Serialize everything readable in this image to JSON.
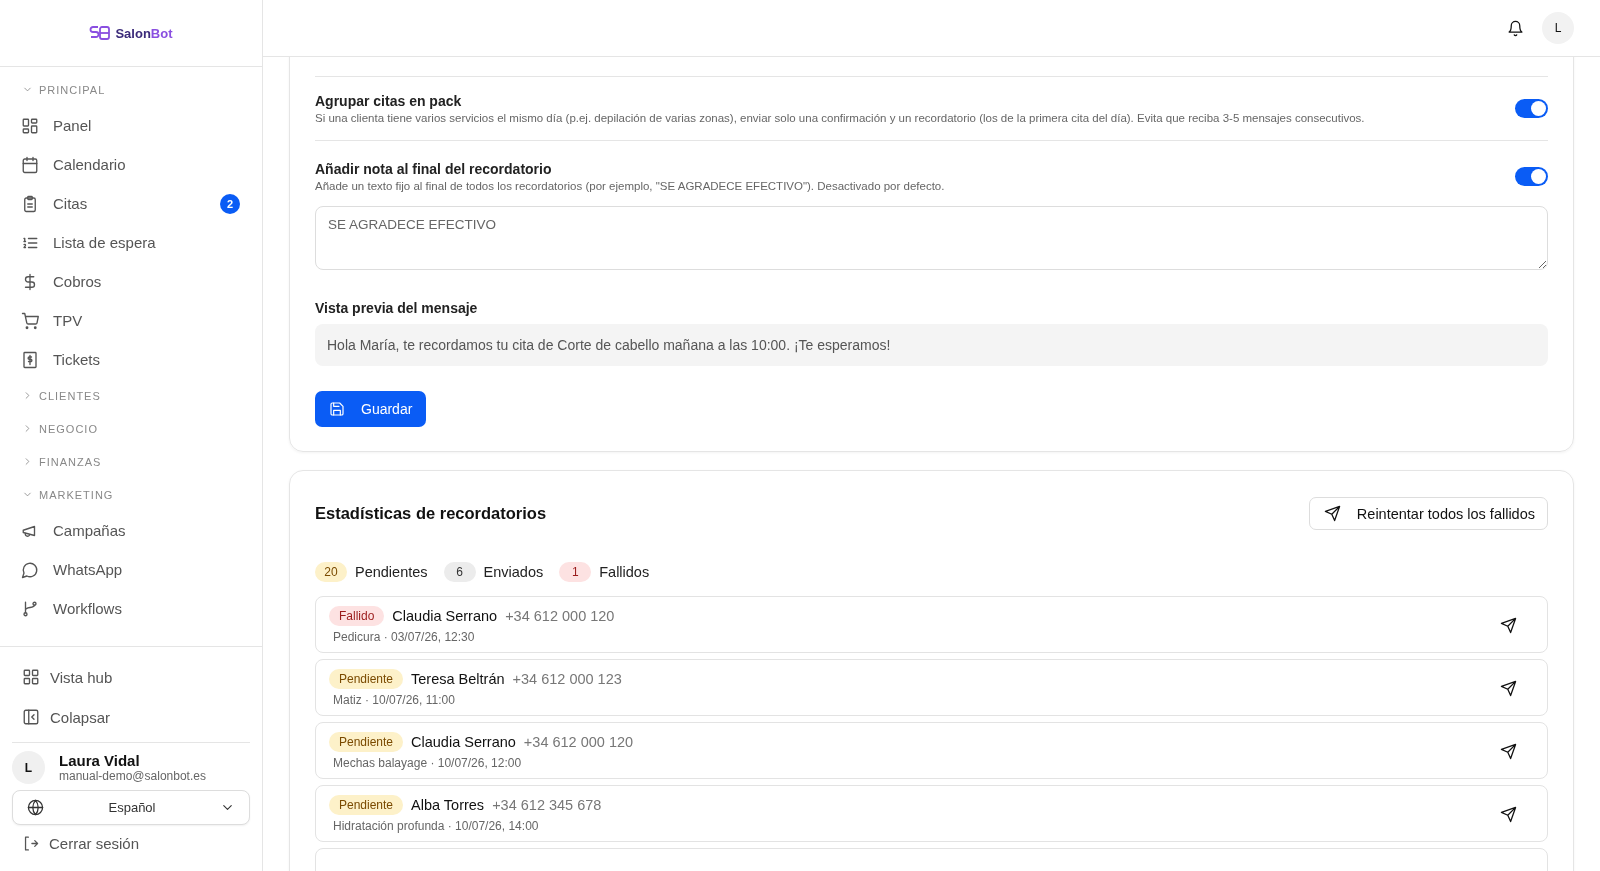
{
  "sidebar": {
    "logo": {
      "text": "Salon",
      "accent": "Bot"
    },
    "sections": [
      {
        "title": "PRINCIPAL",
        "expanded": true,
        "items": [
          {
            "label": "Panel"
          },
          {
            "label": "Calendario"
          },
          {
            "label": "Citas",
            "badge": "2"
          },
          {
            "label": "Lista de espera"
          },
          {
            "label": "Cobros"
          },
          {
            "label": "TPV"
          },
          {
            "label": "Tickets"
          }
        ]
      },
      {
        "title": "CLIENTES",
        "expanded": false
      },
      {
        "title": "NEGOCIO",
        "expanded": false
      },
      {
        "title": "FINANZAS",
        "expanded": false
      },
      {
        "title": "MARKETING",
        "expanded": true,
        "items": [
          {
            "label": "Campañas"
          },
          {
            "label": "WhatsApp"
          },
          {
            "label": "Workflows"
          }
        ]
      }
    ],
    "footer_items": [
      {
        "label": "Vista hub"
      },
      {
        "label": "Colapsar"
      }
    ],
    "user": {
      "initial": "L",
      "name": "Laura Vidal",
      "email": "manual-demo@salonbot.es"
    },
    "language": "Español",
    "logout": "Cerrar sesión"
  },
  "topbar": {
    "avatar": "L"
  },
  "settings": {
    "options": [
      {
        "title": "Agrupar citas en pack",
        "description": "Si una clienta tiene varios servicios el mismo día (p.ej. depilación de varias zonas), enviar solo una confirmación y un recordatorio (los de la primera cita del día). Evita que reciba 3-5 mensajes consecutivos.",
        "on": true
      },
      {
        "title": "Añadir nota al final del recordatorio",
        "description": "Añade un texto fijo al final de todos los recordatorios (por ejemplo, \"SE AGRADECE EFECTIVO\"). Desactivado por defecto.",
        "on": true,
        "value": "SE AGRADECE EFECTIVO"
      }
    ],
    "preview_label": "Vista previa del mensaje",
    "preview": "Hola María, te recordamos tu cita de Corte de cabello mañana a las 10:00. ¡Te esperamos!",
    "save_button": "Guardar"
  },
  "stats": {
    "title": "Estadísticas de recordatorios",
    "retry_button": "Reintentar todos los fallidos",
    "counts": [
      {
        "kind": "pending",
        "count": "20",
        "label": "Pendientes"
      },
      {
        "kind": "sent",
        "count": "6",
        "label": "Enviados"
      },
      {
        "kind": "failed",
        "count": "1",
        "label": "Fallidos"
      }
    ],
    "rows": [
      {
        "kind": "failed",
        "status": "Fallido",
        "name": "Claudia Serrano",
        "phone": "+34 612 000 120",
        "detail": "Pedicura · 03/07/26, 12:30"
      },
      {
        "kind": "pending",
        "status": "Pendiente",
        "name": "Teresa Beltrán",
        "phone": "+34 612 000 123",
        "detail": "Matiz · 10/07/26, 11:00"
      },
      {
        "kind": "pending",
        "status": "Pendiente",
        "name": "Claudia Serrano",
        "phone": "+34 612 000 120",
        "detail": "Mechas balayage · 10/07/26, 12:00"
      },
      {
        "kind": "pending",
        "status": "Pendiente",
        "name": "Alba Torres",
        "phone": "+34 612 345 678",
        "detail": "Hidratación profunda · 10/07/26, 14:00"
      }
    ]
  }
}
